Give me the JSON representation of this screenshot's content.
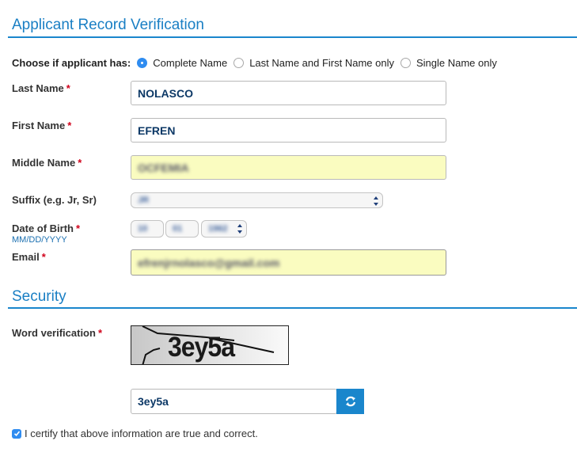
{
  "sections": {
    "applicant_title": "Applicant Record Verification",
    "security_title": "Security"
  },
  "name_type": {
    "label": "Choose if applicant has:",
    "options": [
      {
        "label": "Complete Name",
        "selected": true
      },
      {
        "label": "Last Name and First Name only",
        "selected": false
      },
      {
        "label": "Single Name only",
        "selected": false
      }
    ]
  },
  "fields": {
    "last_name": {
      "label": "Last Name",
      "required": "*",
      "value": "NOLASCO"
    },
    "first_name": {
      "label": "First Name",
      "required": "*",
      "value": "EFREN"
    },
    "middle_name": {
      "label": "Middle Name",
      "required": "*",
      "value": "OCFEMIA"
    },
    "suffix": {
      "label": "Suffix (e.g. Jr, Sr)",
      "value": "JR"
    },
    "dob": {
      "label": "Date of Birth",
      "required": "*",
      "hint": "MM/DD/YYYY",
      "month": "10",
      "day": "01",
      "year": "1962"
    },
    "email": {
      "label": "Email",
      "required": "*",
      "value": "efrenjrnolasco@gmail.com"
    }
  },
  "security": {
    "word_label": "Word verification",
    "required": "*",
    "captcha_text": "3ey5a",
    "answer": "3ey5a",
    "refresh_icon": "refresh-icon"
  },
  "certify": {
    "checked": true,
    "label": "I certify that above information are true and correct."
  },
  "colors": {
    "accent": "#1a86cc",
    "autofill": "#fafcc0",
    "required": "#d0021b"
  }
}
